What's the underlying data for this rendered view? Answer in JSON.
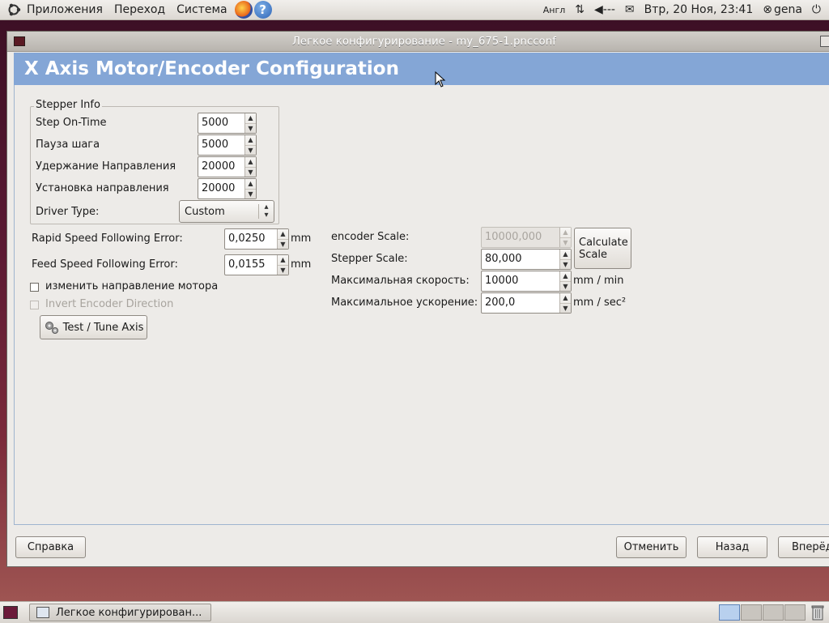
{
  "top_panel": {
    "menu": [
      "Приложения",
      "Переход",
      "Система"
    ],
    "keyboard_layout": "Англ",
    "datetime": "Втр, 20 Ноя, 23:41",
    "user": "gena"
  },
  "window": {
    "title": "Легкое конфигурирование - my_675-1.pncconf",
    "header": "X Axis Motor/Encoder Configuration"
  },
  "stepper_info": {
    "legend": "Stepper Info",
    "step_on_time_label": "Step On-Time",
    "step_on_time_value": "5000",
    "step_pause_label": "Пауза шага",
    "step_pause_value": "5000",
    "dir_hold_label": "Удержание Направления",
    "dir_hold_value": "20000",
    "dir_setup_label": "Установка направления",
    "dir_setup_value": "20000",
    "driver_type_label": "Driver Type:",
    "driver_type_value": "Custom"
  },
  "following": {
    "rapid_label": "Rapid Speed Following Error:",
    "rapid_value": "0,0250",
    "rapid_unit": "mm",
    "feed_label": "Feed Speed Following Error:",
    "feed_value": "0,0155",
    "feed_unit": "mm"
  },
  "checkboxes": {
    "invert_motor": "изменить направление мотора",
    "invert_encoder": "Invert Encoder Direction"
  },
  "buttons": {
    "test_tune": "Test / Tune Axis",
    "calculate_scale_line1": "Calculate",
    "calculate_scale_line2": "Scale",
    "help": "Справка",
    "cancel": "Отменить",
    "back": "Назад",
    "forward": "Вперёд"
  },
  "scale": {
    "encoder_scale_label": "encoder Scale:",
    "encoder_scale_value": "10000,000",
    "stepper_scale_label": "Stepper Scale:",
    "stepper_scale_value": "80,000",
    "max_velocity_label": "Максимальная скорость:",
    "max_velocity_value": "10000",
    "max_velocity_unit": "mm / min",
    "max_accel_label": "Максимальное ускорение:",
    "max_accel_value": "200,0",
    "max_accel_unit": "mm / sec²"
  },
  "taskbar": {
    "task_label": "Легкое конфигурирован..."
  },
  "colors": {
    "header_blue": "#84a6d6",
    "window_bg": "#edebe8"
  }
}
